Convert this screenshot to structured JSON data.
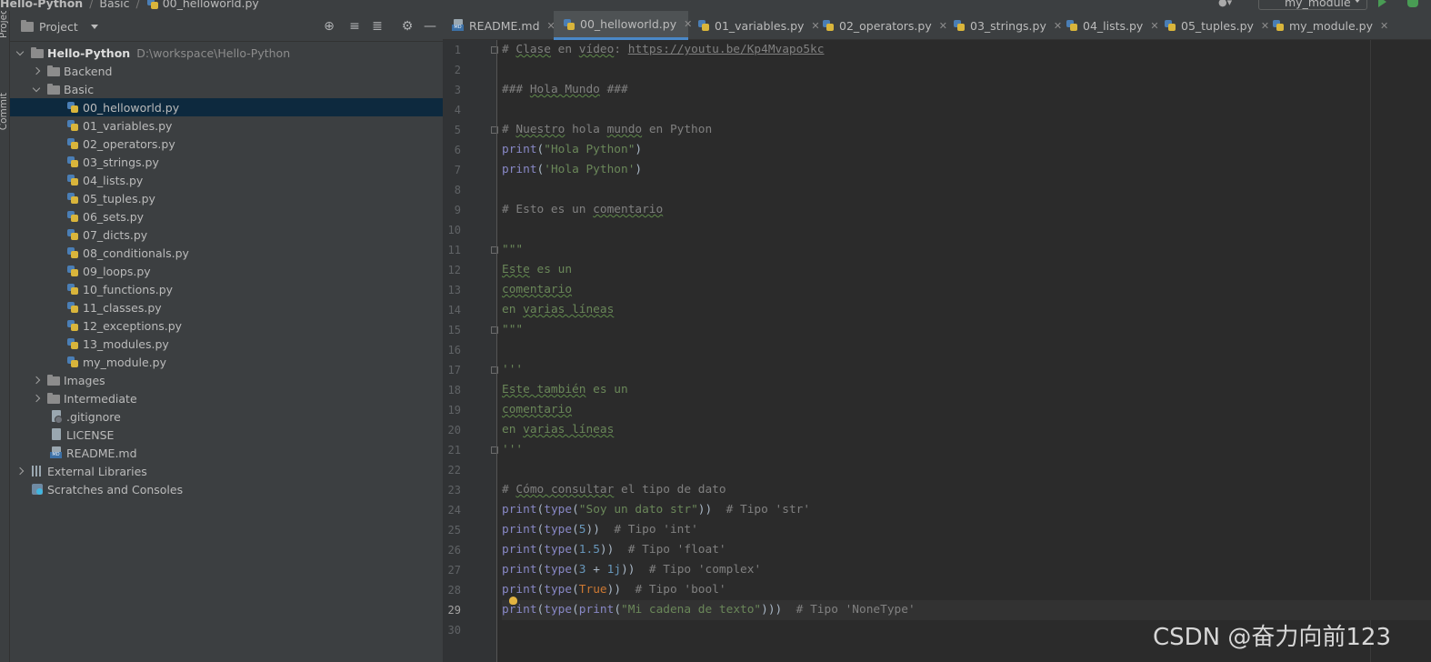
{
  "breadcrumb": [
    "Hello-Python",
    "Basic",
    "00_helloworld.py"
  ],
  "toolbar": {
    "run_config": "my_module",
    "user_icon": "user-icon",
    "run_icon": "run-icon",
    "debug_icon": "debug-icon"
  },
  "tool_stripe": {
    "project_label": "Project",
    "commit_label": "Commit"
  },
  "project": {
    "title": "Project",
    "root": {
      "name": "Hello-Python",
      "path": "D:\\workspace\\Hello-Python"
    },
    "items": [
      {
        "label": "Backend",
        "type": "folder",
        "expanded": false
      },
      {
        "label": "Basic",
        "type": "folder",
        "expanded": true
      },
      {
        "label": "00_helloworld.py",
        "type": "py",
        "selected": true
      },
      {
        "label": "01_variables.py",
        "type": "py"
      },
      {
        "label": "02_operators.py",
        "type": "py"
      },
      {
        "label": "03_strings.py",
        "type": "py"
      },
      {
        "label": "04_lists.py",
        "type": "py"
      },
      {
        "label": "05_tuples.py",
        "type": "py"
      },
      {
        "label": "06_sets.py",
        "type": "py"
      },
      {
        "label": "07_dicts.py",
        "type": "py"
      },
      {
        "label": "08_conditionals.py",
        "type": "py"
      },
      {
        "label": "09_loops.py",
        "type": "py"
      },
      {
        "label": "10_functions.py",
        "type": "py"
      },
      {
        "label": "11_classes.py",
        "type": "py"
      },
      {
        "label": "12_exceptions.py",
        "type": "py"
      },
      {
        "label": "13_modules.py",
        "type": "py"
      },
      {
        "label": "my_module.py",
        "type": "py"
      },
      {
        "label": "Images",
        "type": "folder",
        "expanded": false
      },
      {
        "label": "Intermediate",
        "type": "folder",
        "expanded": false
      },
      {
        "label": ".gitignore",
        "type": "file"
      },
      {
        "label": "LICENSE",
        "type": "file"
      },
      {
        "label": "README.md",
        "type": "md"
      },
      {
        "label": "External Libraries",
        "type": "lib"
      },
      {
        "label": "Scratches and Consoles",
        "type": "scratch"
      }
    ]
  },
  "tabs": [
    {
      "label": "README.md",
      "active": false
    },
    {
      "label": "00_helloworld.py",
      "active": true
    },
    {
      "label": "01_variables.py",
      "active": false
    },
    {
      "label": "02_operators.py",
      "active": false
    },
    {
      "label": "03_strings.py",
      "active": false
    },
    {
      "label": "04_lists.py",
      "active": false
    },
    {
      "label": "05_tuples.py",
      "active": false
    },
    {
      "label": "my_module.py",
      "active": false
    }
  ],
  "editor": {
    "current_line": 29,
    "lines": [
      "# Clase en vídeo: https://youtu.be/Kp4Mvapo5kc",
      "",
      "### Hola Mundo ###",
      "",
      "# Nuestro hola mundo en Python",
      "print(\"Hola Python\")",
      "print('Hola Python')",
      "",
      "# Esto es un comentario",
      "",
      "\"\"\"",
      "Este es un",
      "comentario",
      "en varias líneas",
      "\"\"\"",
      "",
      "'''",
      "Este también es un",
      "comentario",
      "en varias líneas",
      "'''",
      "",
      "# Cómo consultar el tipo de dato",
      "print(type(\"Soy un dato str\"))  # Tipo 'str'",
      "print(type(5))  # Tipo 'int'",
      "print(type(1.5))  # Tipo 'float'",
      "print(type(3 + 1j))  # Tipo 'complex'",
      "print(type(True))  # Tipo 'bool'",
      "print(type(print(\"Mi cadena de texto\")))  # Tipo 'NoneType'",
      ""
    ]
  },
  "watermark": "CSDN @奋力向前123",
  "colors": {
    "selection": "#0d293e",
    "accent": "#4a88c7",
    "comment": "#808080",
    "string": "#6a8759",
    "keyword": "#cc7832",
    "builtin": "#8888c6",
    "number": "#6897bb"
  }
}
